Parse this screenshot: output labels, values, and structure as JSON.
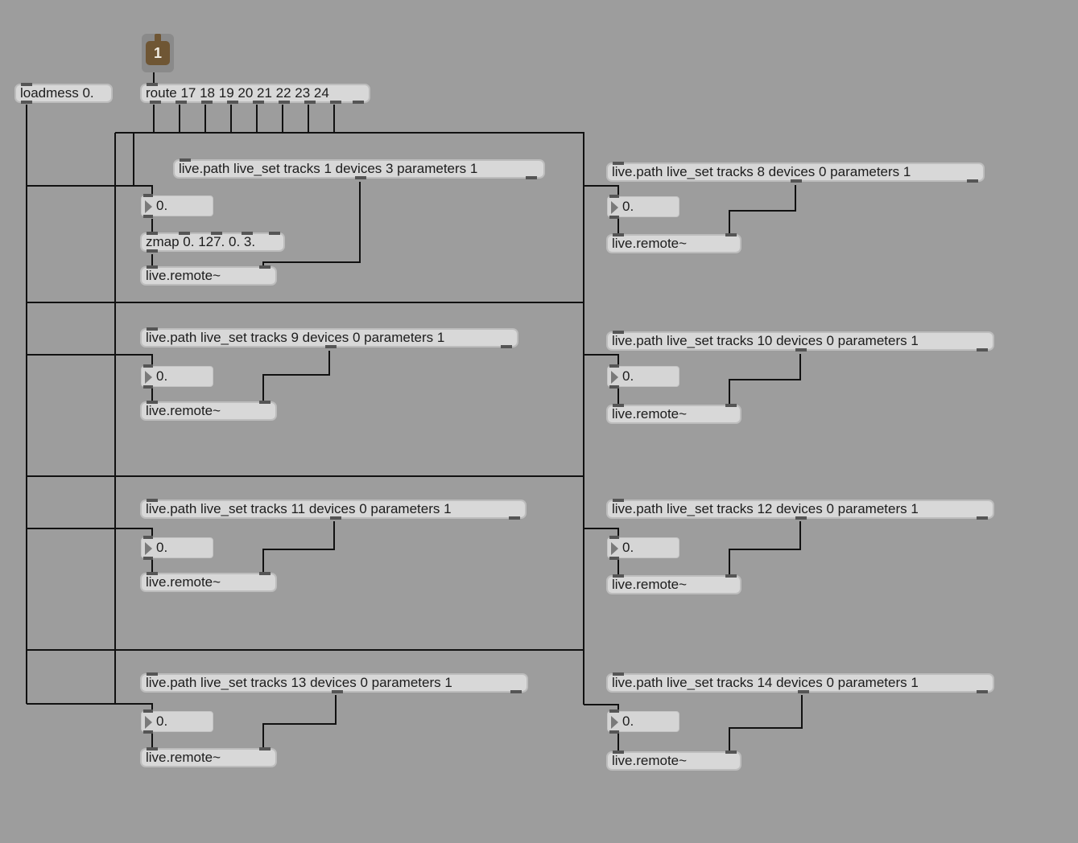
{
  "inlet_port": {
    "number": "1"
  },
  "loadmess": {
    "text": "loadmess 0."
  },
  "route": {
    "text": "route 17 18 19 20 21 22 23 24"
  },
  "zmap": {
    "text": "zmap 0. 127. 0. 3."
  },
  "groups": [
    {
      "path": "live.path live_set tracks 1 devices 3 parameters 1",
      "number": "0.",
      "remote": "live.remote~"
    },
    {
      "path": "live.path live_set tracks 8 devices 0 parameters 1",
      "number": "0.",
      "remote": "live.remote~"
    },
    {
      "path": "live.path live_set tracks 9 devices 0 parameters 1",
      "number": "0.",
      "remote": "live.remote~"
    },
    {
      "path": "live.path live_set tracks 10 devices 0 parameters 1",
      "number": "0.",
      "remote": "live.remote~"
    },
    {
      "path": "live.path live_set tracks 11 devices 0 parameters 1",
      "number": "0.",
      "remote": "live.remote~"
    },
    {
      "path": "live.path live_set tracks 12 devices 0 parameters 1",
      "number": "0.",
      "remote": "live.remote~"
    },
    {
      "path": "live.path live_set tracks 13 devices 0 parameters 1",
      "number": "0.",
      "remote": "live.remote~"
    },
    {
      "path": "live.path live_set tracks 14 devices 0 parameters 1",
      "number": "0.",
      "remote": "live.remote~"
    }
  ]
}
